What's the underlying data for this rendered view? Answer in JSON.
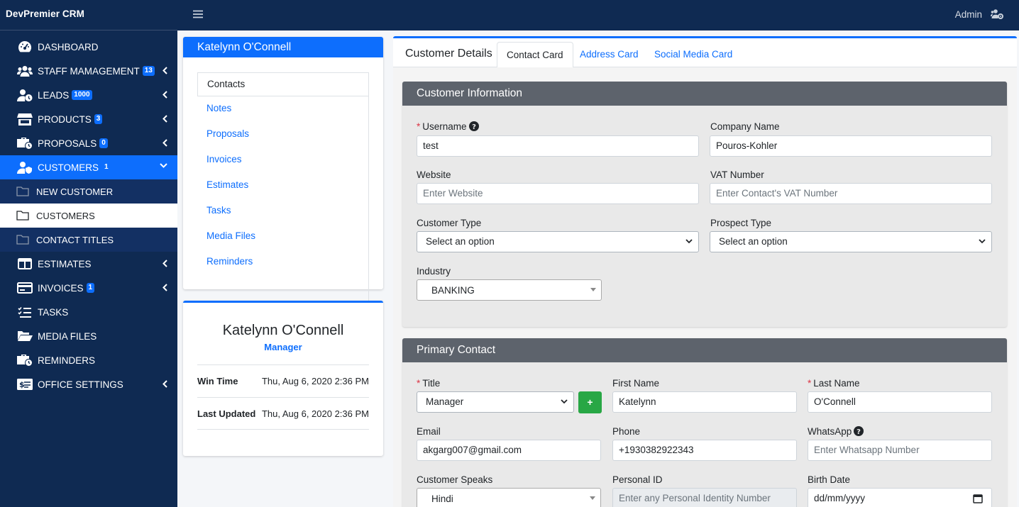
{
  "app": {
    "brand": "DevPremier CRM",
    "user": "Admin"
  },
  "sidebar": {
    "items": [
      {
        "label": "DASHBOARD",
        "icon": "dashboard-icon"
      },
      {
        "label": "STAFF MAMAGEMENT",
        "badge": "13",
        "icon": "users-icon"
      },
      {
        "label": "LEADS",
        "badge": "1000",
        "icon": "user-clock-icon"
      },
      {
        "label": "PRODUCTS",
        "badge": "3",
        "icon": "store-icon"
      },
      {
        "label": "PROPOSALS",
        "badge": "0",
        "icon": "briefcase-clock-icon"
      },
      {
        "label": "CUSTOMERS",
        "badge": "1",
        "icon": "user-shield-icon"
      },
      {
        "label": "NEW CUSTOMER",
        "icon": "folder-icon"
      },
      {
        "label": "CUSTOMERS",
        "icon": "folder-icon"
      },
      {
        "label": "CONTACT TITLES",
        "icon": "folder-icon"
      },
      {
        "label": "ESTIMATES",
        "icon": "columns-icon"
      },
      {
        "label": "INVOICES",
        "badge": "1",
        "icon": "credit-card-icon"
      },
      {
        "label": "TASKS",
        "icon": "tasks-icon"
      },
      {
        "label": "MEDIA FILES",
        "icon": "folder-open-icon"
      },
      {
        "label": "REMINDERS",
        "icon": "briefcase-clock-icon"
      },
      {
        "label": "OFFICE SETTINGS",
        "icon": "money-check-icon"
      }
    ]
  },
  "customer_nav": {
    "name": "Katelynn O'Connell",
    "items": [
      "Contacts",
      "Notes",
      "Proposals",
      "Invoices",
      "Estimates",
      "Tasks",
      "Media Files",
      "Reminders"
    ]
  },
  "profile": {
    "name": "Katelynn O'Connell",
    "role": "Manager",
    "rows": [
      {
        "label": "Win Time",
        "value": "Thu, Aug 6, 2020 2:36 PM"
      },
      {
        "label": "Last Updated",
        "value": "Thu, Aug 6, 2020 2:36 PM"
      }
    ]
  },
  "tabs": {
    "title": "Customer Details",
    "items": [
      "Contact Card",
      "Address Card",
      "Social Media Card"
    ],
    "active": "Contact Card"
  },
  "customer_info": {
    "heading": "Customer Information",
    "username": {
      "label": "Username",
      "value": "test"
    },
    "company": {
      "label": "Company Name",
      "value": "Pouros-Kohler"
    },
    "website": {
      "label": "Website",
      "placeholder": "Enter Website"
    },
    "vat": {
      "label": "VAT Number",
      "placeholder": "Enter Contact's VAT Number"
    },
    "customer_type": {
      "label": "Customer Type",
      "value": "Select an option"
    },
    "prospect_type": {
      "label": "Prospect Type",
      "value": "Select an option"
    },
    "industry": {
      "label": "Industry",
      "value": "BANKING"
    }
  },
  "primary_contact": {
    "heading": "Primary Contact",
    "title": {
      "label": "Title",
      "value": "Manager",
      "add": "+"
    },
    "first_name": {
      "label": "First Name",
      "value": "Katelynn"
    },
    "last_name": {
      "label": "Last Name",
      "value": "O'Connell"
    },
    "email": {
      "label": "Email",
      "value": "akgarg007@gmail.com"
    },
    "phone": {
      "label": "Phone",
      "value": "+1930382922343"
    },
    "whatsapp": {
      "label": "WhatsApp",
      "placeholder": "Enter Whatsapp Number"
    },
    "speaks": {
      "label": "Customer Speaks",
      "value": "Hindi"
    },
    "personal_id": {
      "label": "Personal ID",
      "placeholder": "Enter any Personal Identity Number"
    },
    "birth_date": {
      "label": "Birth Date",
      "placeholder": "dd/mm/yyyy"
    }
  },
  "colors": {
    "sidebar": "#0f2a52",
    "accent": "#0d6efd",
    "section_header": "#5d636c",
    "add_button": "#28a745"
  }
}
